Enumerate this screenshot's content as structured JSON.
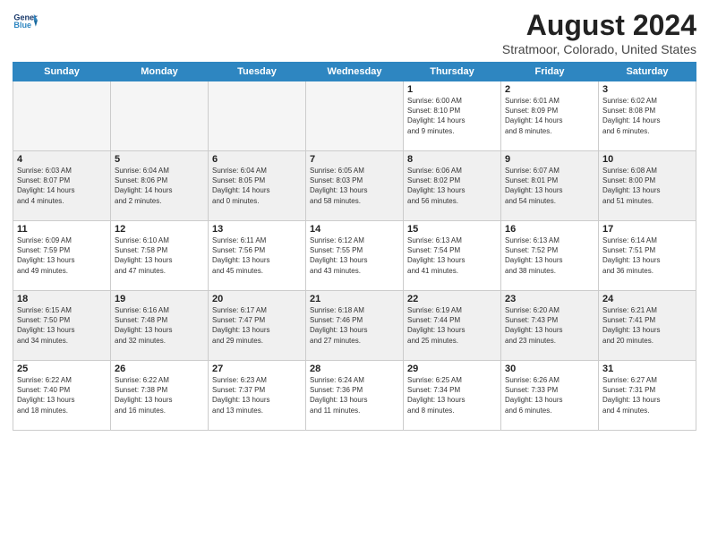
{
  "header": {
    "logo_line1": "General",
    "logo_line2": "Blue",
    "month_title": "August 2024",
    "location": "Stratmoor, Colorado, United States"
  },
  "weekdays": [
    "Sunday",
    "Monday",
    "Tuesday",
    "Wednesday",
    "Thursday",
    "Friday",
    "Saturday"
  ],
  "weeks": [
    [
      {
        "day": "",
        "info": "",
        "empty": true
      },
      {
        "day": "",
        "info": "",
        "empty": true
      },
      {
        "day": "",
        "info": "",
        "empty": true
      },
      {
        "day": "",
        "info": "",
        "empty": true
      },
      {
        "day": "1",
        "info": "Sunrise: 6:00 AM\nSunset: 8:10 PM\nDaylight: 14 hours\nand 9 minutes."
      },
      {
        "day": "2",
        "info": "Sunrise: 6:01 AM\nSunset: 8:09 PM\nDaylight: 14 hours\nand 8 minutes."
      },
      {
        "day": "3",
        "info": "Sunrise: 6:02 AM\nSunset: 8:08 PM\nDaylight: 14 hours\nand 6 minutes."
      }
    ],
    [
      {
        "day": "4",
        "info": "Sunrise: 6:03 AM\nSunset: 8:07 PM\nDaylight: 14 hours\nand 4 minutes."
      },
      {
        "day": "5",
        "info": "Sunrise: 6:04 AM\nSunset: 8:06 PM\nDaylight: 14 hours\nand 2 minutes."
      },
      {
        "day": "6",
        "info": "Sunrise: 6:04 AM\nSunset: 8:05 PM\nDaylight: 14 hours\nand 0 minutes."
      },
      {
        "day": "7",
        "info": "Sunrise: 6:05 AM\nSunset: 8:03 PM\nDaylight: 13 hours\nand 58 minutes."
      },
      {
        "day": "8",
        "info": "Sunrise: 6:06 AM\nSunset: 8:02 PM\nDaylight: 13 hours\nand 56 minutes."
      },
      {
        "day": "9",
        "info": "Sunrise: 6:07 AM\nSunset: 8:01 PM\nDaylight: 13 hours\nand 54 minutes."
      },
      {
        "day": "10",
        "info": "Sunrise: 6:08 AM\nSunset: 8:00 PM\nDaylight: 13 hours\nand 51 minutes."
      }
    ],
    [
      {
        "day": "11",
        "info": "Sunrise: 6:09 AM\nSunset: 7:59 PM\nDaylight: 13 hours\nand 49 minutes."
      },
      {
        "day": "12",
        "info": "Sunrise: 6:10 AM\nSunset: 7:58 PM\nDaylight: 13 hours\nand 47 minutes."
      },
      {
        "day": "13",
        "info": "Sunrise: 6:11 AM\nSunset: 7:56 PM\nDaylight: 13 hours\nand 45 minutes."
      },
      {
        "day": "14",
        "info": "Sunrise: 6:12 AM\nSunset: 7:55 PM\nDaylight: 13 hours\nand 43 minutes."
      },
      {
        "day": "15",
        "info": "Sunrise: 6:13 AM\nSunset: 7:54 PM\nDaylight: 13 hours\nand 41 minutes."
      },
      {
        "day": "16",
        "info": "Sunrise: 6:13 AM\nSunset: 7:52 PM\nDaylight: 13 hours\nand 38 minutes."
      },
      {
        "day": "17",
        "info": "Sunrise: 6:14 AM\nSunset: 7:51 PM\nDaylight: 13 hours\nand 36 minutes."
      }
    ],
    [
      {
        "day": "18",
        "info": "Sunrise: 6:15 AM\nSunset: 7:50 PM\nDaylight: 13 hours\nand 34 minutes."
      },
      {
        "day": "19",
        "info": "Sunrise: 6:16 AM\nSunset: 7:48 PM\nDaylight: 13 hours\nand 32 minutes."
      },
      {
        "day": "20",
        "info": "Sunrise: 6:17 AM\nSunset: 7:47 PM\nDaylight: 13 hours\nand 29 minutes."
      },
      {
        "day": "21",
        "info": "Sunrise: 6:18 AM\nSunset: 7:46 PM\nDaylight: 13 hours\nand 27 minutes."
      },
      {
        "day": "22",
        "info": "Sunrise: 6:19 AM\nSunset: 7:44 PM\nDaylight: 13 hours\nand 25 minutes."
      },
      {
        "day": "23",
        "info": "Sunrise: 6:20 AM\nSunset: 7:43 PM\nDaylight: 13 hours\nand 23 minutes."
      },
      {
        "day": "24",
        "info": "Sunrise: 6:21 AM\nSunset: 7:41 PM\nDaylight: 13 hours\nand 20 minutes."
      }
    ],
    [
      {
        "day": "25",
        "info": "Sunrise: 6:22 AM\nSunset: 7:40 PM\nDaylight: 13 hours\nand 18 minutes."
      },
      {
        "day": "26",
        "info": "Sunrise: 6:22 AM\nSunset: 7:38 PM\nDaylight: 13 hours\nand 16 minutes."
      },
      {
        "day": "27",
        "info": "Sunrise: 6:23 AM\nSunset: 7:37 PM\nDaylight: 13 hours\nand 13 minutes."
      },
      {
        "day": "28",
        "info": "Sunrise: 6:24 AM\nSunset: 7:36 PM\nDaylight: 13 hours\nand 11 minutes."
      },
      {
        "day": "29",
        "info": "Sunrise: 6:25 AM\nSunset: 7:34 PM\nDaylight: 13 hours\nand 8 minutes."
      },
      {
        "day": "30",
        "info": "Sunrise: 6:26 AM\nSunset: 7:33 PM\nDaylight: 13 hours\nand 6 minutes."
      },
      {
        "day": "31",
        "info": "Sunrise: 6:27 AM\nSunset: 7:31 PM\nDaylight: 13 hours\nand 4 minutes."
      }
    ]
  ]
}
